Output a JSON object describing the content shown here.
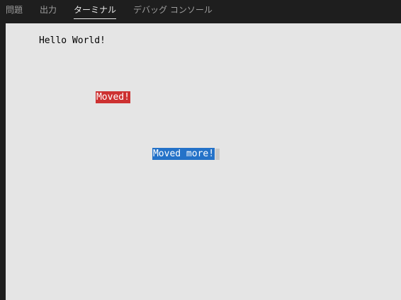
{
  "tabs": [
    {
      "label": "問題",
      "active": false
    },
    {
      "label": "出力",
      "active": false
    },
    {
      "label": "ターミナル",
      "active": true
    },
    {
      "label": "デバッグ コンソール",
      "active": false
    }
  ],
  "terminal": {
    "line1": "Hello World!",
    "line2": "Moved!",
    "line3": "Moved more!"
  },
  "colors": {
    "terminal_bg": "#e5e5e5",
    "red_highlight": "#cd3131",
    "blue_highlight": "#2472c8",
    "tab_active": "#e7e7e7",
    "tab_inactive": "#9d9d9d"
  }
}
